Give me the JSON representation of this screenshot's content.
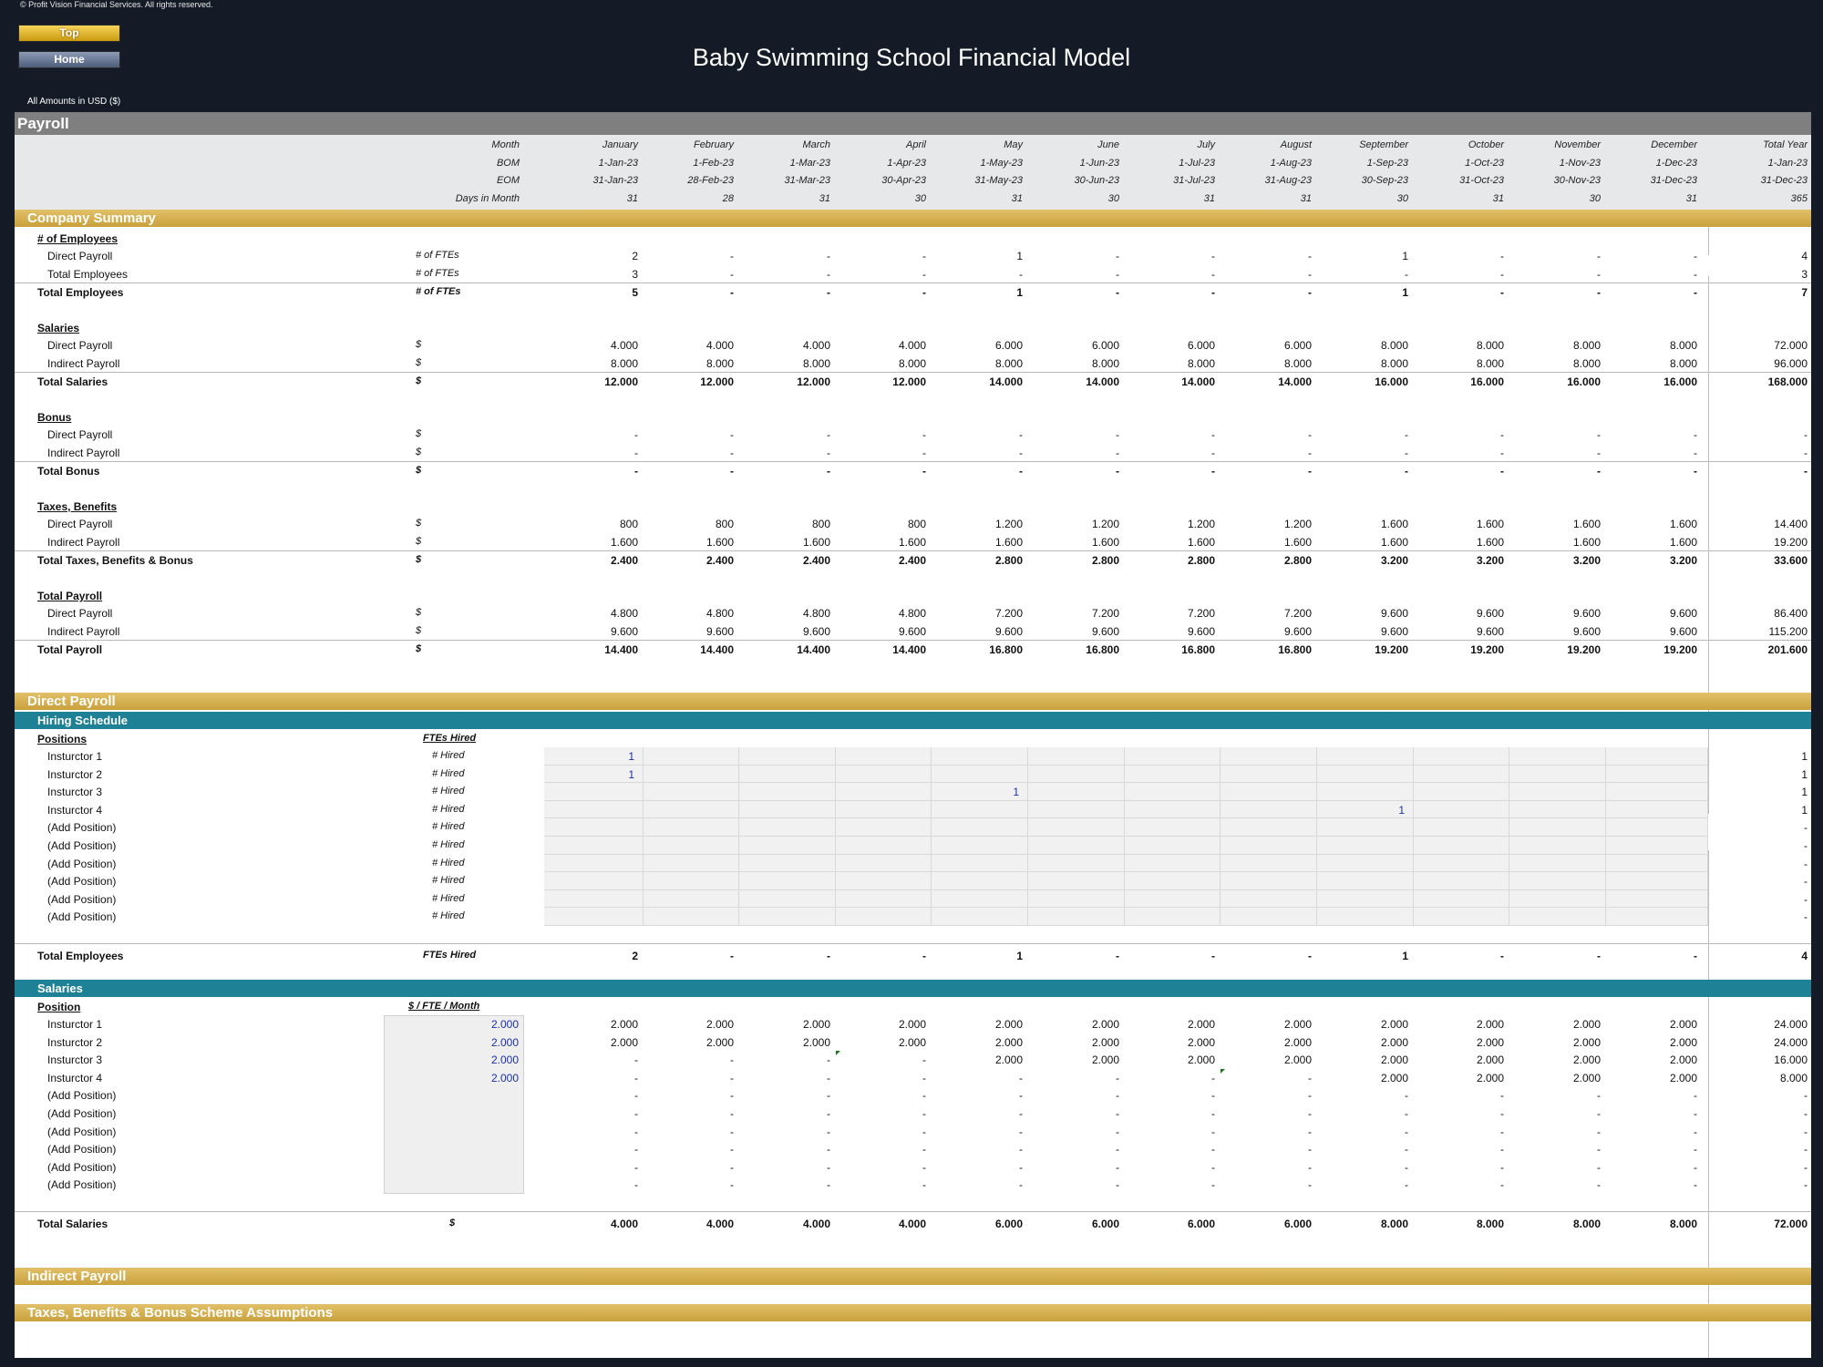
{
  "copyright": "© Profit Vision Financial Services. All rights reserved.",
  "buttons": {
    "top": "Top",
    "home": "Home"
  },
  "title": "Baby Swimming School Financial Model",
  "amounts_label": "All Amounts in  USD ($)",
  "sheet_title": "Payroll",
  "header": {
    "rows": [
      {
        "label": "Month",
        "values": [
          "January",
          "February",
          "March",
          "April",
          "May",
          "June",
          "July",
          "August",
          "September",
          "October",
          "November",
          "December",
          "Total Year"
        ]
      },
      {
        "label": "BOM",
        "values": [
          "1-Jan-23",
          "1-Feb-23",
          "1-Mar-23",
          "1-Apr-23",
          "1-May-23",
          "1-Jun-23",
          "1-Jul-23",
          "1-Aug-23",
          "1-Sep-23",
          "1-Oct-23",
          "1-Nov-23",
          "1-Dec-23",
          "1-Jan-23"
        ]
      },
      {
        "label": "EOM",
        "values": [
          "31-Jan-23",
          "28-Feb-23",
          "31-Mar-23",
          "30-Apr-23",
          "31-May-23",
          "30-Jun-23",
          "31-Jul-23",
          "31-Aug-23",
          "30-Sep-23",
          "31-Oct-23",
          "30-Nov-23",
          "31-Dec-23",
          "31-Dec-23"
        ]
      },
      {
        "label": "Days in Month",
        "values": [
          "31",
          "28",
          "31",
          "30",
          "31",
          "30",
          "31",
          "31",
          "30",
          "31",
          "30",
          "31",
          "365"
        ]
      }
    ]
  },
  "company_summary": {
    "title": "Company Summary",
    "blocks": [
      {
        "heading": "# of Employees",
        "rows": [
          {
            "label": "Direct Payroll",
            "unit": "# of FTEs",
            "values": [
              "2",
              "-",
              "-",
              "-",
              "1",
              "-",
              "-",
              "-",
              "1",
              "-",
              "-",
              "-",
              "4"
            ]
          },
          {
            "label": "Total Employees",
            "unit": "# of FTEs",
            "values": [
              "3",
              "-",
              "-",
              "-",
              "-",
              "-",
              "-",
              "-",
              "-",
              "-",
              "-",
              "-",
              "3"
            ]
          }
        ],
        "total": {
          "label": "Total Employees",
          "unit": "# of FTEs",
          "values": [
            "5",
            "-",
            "-",
            "-",
            "1",
            "-",
            "-",
            "-",
            "1",
            "-",
            "-",
            "-",
            "7"
          ]
        }
      },
      {
        "heading": "Salaries",
        "rows": [
          {
            "label": "Direct Payroll",
            "unit": "$",
            "values": [
              "4.000",
              "4.000",
              "4.000",
              "4.000",
              "6.000",
              "6.000",
              "6.000",
              "6.000",
              "8.000",
              "8.000",
              "8.000",
              "8.000",
              "72.000"
            ]
          },
          {
            "label": "Indirect Payroll",
            "unit": "$",
            "values": [
              "8.000",
              "8.000",
              "8.000",
              "8.000",
              "8.000",
              "8.000",
              "8.000",
              "8.000",
              "8.000",
              "8.000",
              "8.000",
              "8.000",
              "96.000"
            ]
          }
        ],
        "total": {
          "label": "Total Salaries",
          "unit": "$",
          "values": [
            "12.000",
            "12.000",
            "12.000",
            "12.000",
            "14.000",
            "14.000",
            "14.000",
            "14.000",
            "16.000",
            "16.000",
            "16.000",
            "16.000",
            "168.000"
          ]
        }
      },
      {
        "heading": "Bonus",
        "rows": [
          {
            "label": "Direct Payroll",
            "unit": "$",
            "values": [
              "-",
              "-",
              "-",
              "-",
              "-",
              "-",
              "-",
              "-",
              "-",
              "-",
              "-",
              "-",
              "-"
            ]
          },
          {
            "label": "Indirect Payroll",
            "unit": "$",
            "values": [
              "-",
              "-",
              "-",
              "-",
              "-",
              "-",
              "-",
              "-",
              "-",
              "-",
              "-",
              "-",
              "-"
            ]
          }
        ],
        "total": {
          "label": "Total Bonus",
          "unit": "$",
          "values": [
            "-",
            "-",
            "-",
            "-",
            "-",
            "-",
            "-",
            "-",
            "-",
            "-",
            "-",
            "-",
            "-"
          ]
        }
      },
      {
        "heading": "Taxes, Benefits",
        "rows": [
          {
            "label": "Direct Payroll",
            "unit": "$",
            "values": [
              "800",
              "800",
              "800",
              "800",
              "1.200",
              "1.200",
              "1.200",
              "1.200",
              "1.600",
              "1.600",
              "1.600",
              "1.600",
              "14.400"
            ]
          },
          {
            "label": "Indirect Payroll",
            "unit": "$",
            "values": [
              "1.600",
              "1.600",
              "1.600",
              "1.600",
              "1.600",
              "1.600",
              "1.600",
              "1.600",
              "1.600",
              "1.600",
              "1.600",
              "1.600",
              "19.200"
            ]
          }
        ],
        "total": {
          "label": "Total Taxes, Benefits & Bonus",
          "unit": "$",
          "values": [
            "2.400",
            "2.400",
            "2.400",
            "2.400",
            "2.800",
            "2.800",
            "2.800",
            "2.800",
            "3.200",
            "3.200",
            "3.200",
            "3.200",
            "33.600"
          ]
        }
      },
      {
        "heading": "Total Payroll",
        "rows": [
          {
            "label": "Direct Payroll",
            "unit": "$",
            "values": [
              "4.800",
              "4.800",
              "4.800",
              "4.800",
              "7.200",
              "7.200",
              "7.200",
              "7.200",
              "9.600",
              "9.600",
              "9.600",
              "9.600",
              "86.400"
            ]
          },
          {
            "label": "Indirect Payroll",
            "unit": "$",
            "values": [
              "9.600",
              "9.600",
              "9.600",
              "9.600",
              "9.600",
              "9.600",
              "9.600",
              "9.600",
              "9.600",
              "9.600",
              "9.600",
              "9.600",
              "115.200"
            ]
          }
        ],
        "total": {
          "label": "Total Payroll",
          "unit": "$",
          "values": [
            "14.400",
            "14.400",
            "14.400",
            "14.400",
            "16.800",
            "16.800",
            "16.800",
            "16.800",
            "19.200",
            "19.200",
            "19.200",
            "19.200",
            "201.600"
          ]
        }
      }
    ]
  },
  "direct_payroll": {
    "title": "Direct Payroll",
    "hiring": {
      "title": "Hiring Schedule",
      "col_label": "Positions",
      "unit_header": "FTEs Hired",
      "rows": [
        {
          "label": "Insturctor 1",
          "unit": "# Hired",
          "values": [
            "1",
            "",
            "",
            "",
            "",
            "",
            "",
            "",
            "",
            "",
            "",
            "",
            ""
          ],
          "total": "1"
        },
        {
          "label": "Insturctor 2",
          "unit": "# Hired",
          "values": [
            "1",
            "",
            "",
            "",
            "",
            "",
            "",
            "",
            "",
            "",
            "",
            "",
            ""
          ],
          "total": "1"
        },
        {
          "label": "Insturctor 3",
          "unit": "# Hired",
          "values": [
            "",
            "",
            "",
            "",
            "1",
            "",
            "",
            "",
            "",
            "",
            "",
            "",
            ""
          ],
          "total": "1"
        },
        {
          "label": "Insturctor 4",
          "unit": "# Hired",
          "values": [
            "",
            "",
            "",
            "",
            "",
            "",
            "",
            "",
            "1",
            "",
            "",
            "",
            ""
          ],
          "total": "1"
        },
        {
          "label": "(Add Position)",
          "unit": "# Hired",
          "values": [
            "",
            "",
            "",
            "",
            "",
            "",
            "",
            "",
            "",
            "",
            "",
            "",
            ""
          ],
          "total": "-"
        },
        {
          "label": "(Add Position)",
          "unit": "# Hired",
          "values": [
            "",
            "",
            "",
            "",
            "",
            "",
            "",
            "",
            "",
            "",
            "",
            "",
            ""
          ],
          "total": "-"
        },
        {
          "label": "(Add Position)",
          "unit": "# Hired",
          "values": [
            "",
            "",
            "",
            "",
            "",
            "",
            "",
            "",
            "",
            "",
            "",
            "",
            ""
          ],
          "total": "-"
        },
        {
          "label": "(Add Position)",
          "unit": "# Hired",
          "values": [
            "",
            "",
            "",
            "",
            "",
            "",
            "",
            "",
            "",
            "",
            "",
            "",
            ""
          ],
          "total": "-"
        },
        {
          "label": "(Add Position)",
          "unit": "# Hired",
          "values": [
            "",
            "",
            "",
            "",
            "",
            "",
            "",
            "",
            "",
            "",
            "",
            "",
            ""
          ],
          "total": "-"
        },
        {
          "label": "(Add Position)",
          "unit": "# Hired",
          "values": [
            "",
            "",
            "",
            "",
            "",
            "",
            "",
            "",
            "",
            "",
            "",
            "",
            ""
          ],
          "total": "-"
        }
      ],
      "total": {
        "label": "Total Employees",
        "unit": "FTEs Hired",
        "values": [
          "2",
          "-",
          "-",
          "-",
          "1",
          "-",
          "-",
          "-",
          "1",
          "-",
          "-",
          "-",
          "4"
        ]
      }
    },
    "salaries": {
      "title": "Salaries",
      "col_label": "Position",
      "unit_header": "$ / FTE / Month",
      "rows": [
        {
          "label": "Insturctor 1",
          "input": "2.000",
          "values": [
            "2.000",
            "2.000",
            "2.000",
            "2.000",
            "2.000",
            "2.000",
            "2.000",
            "2.000",
            "2.000",
            "2.000",
            "2.000",
            "2.000",
            "24.000"
          ]
        },
        {
          "label": "Insturctor 2",
          "input": "2.000",
          "values": [
            "2.000",
            "2.000",
            "2.000",
            "2.000",
            "2.000",
            "2.000",
            "2.000",
            "2.000",
            "2.000",
            "2.000",
            "2.000",
            "2.000",
            "24.000"
          ]
        },
        {
          "label": "Insturctor 3",
          "input": "2.000",
          "values": [
            "-",
            "-",
            "-",
            "-",
            "2.000",
            "2.000",
            "2.000",
            "2.000",
            "2.000",
            "2.000",
            "2.000",
            "2.000",
            "16.000"
          ]
        },
        {
          "label": "Insturctor 4",
          "input": "2.000",
          "values": [
            "-",
            "-",
            "-",
            "-",
            "-",
            "-",
            "-",
            "-",
            "2.000",
            "2.000",
            "2.000",
            "2.000",
            "8.000"
          ]
        },
        {
          "label": "(Add Position)",
          "input": "",
          "values": [
            "-",
            "-",
            "-",
            "-",
            "-",
            "-",
            "-",
            "-",
            "-",
            "-",
            "-",
            "-",
            "-"
          ]
        },
        {
          "label": "(Add Position)",
          "input": "",
          "values": [
            "-",
            "-",
            "-",
            "-",
            "-",
            "-",
            "-",
            "-",
            "-",
            "-",
            "-",
            "-",
            "-"
          ]
        },
        {
          "label": "(Add Position)",
          "input": "",
          "values": [
            "-",
            "-",
            "-",
            "-",
            "-",
            "-",
            "-",
            "-",
            "-",
            "-",
            "-",
            "-",
            "-"
          ]
        },
        {
          "label": "(Add Position)",
          "input": "",
          "values": [
            "-",
            "-",
            "-",
            "-",
            "-",
            "-",
            "-",
            "-",
            "-",
            "-",
            "-",
            "-",
            "-"
          ]
        },
        {
          "label": "(Add Position)",
          "input": "",
          "values": [
            "-",
            "-",
            "-",
            "-",
            "-",
            "-",
            "-",
            "-",
            "-",
            "-",
            "-",
            "-",
            "-"
          ]
        },
        {
          "label": "(Add Position)",
          "input": "",
          "values": [
            "-",
            "-",
            "-",
            "-",
            "-",
            "-",
            "-",
            "-",
            "-",
            "-",
            "-",
            "-",
            "-"
          ]
        }
      ],
      "total": {
        "label": "Total Salaries",
        "unit": "$",
        "values": [
          "4.000",
          "4.000",
          "4.000",
          "4.000",
          "6.000",
          "6.000",
          "6.000",
          "6.000",
          "8.000",
          "8.000",
          "8.000",
          "8.000",
          "72.000"
        ]
      }
    }
  },
  "indirect_payroll": {
    "title": "Indirect Payroll"
  },
  "assumptions": {
    "title": "Taxes, Benefits & Bonus Scheme Assumptions"
  }
}
